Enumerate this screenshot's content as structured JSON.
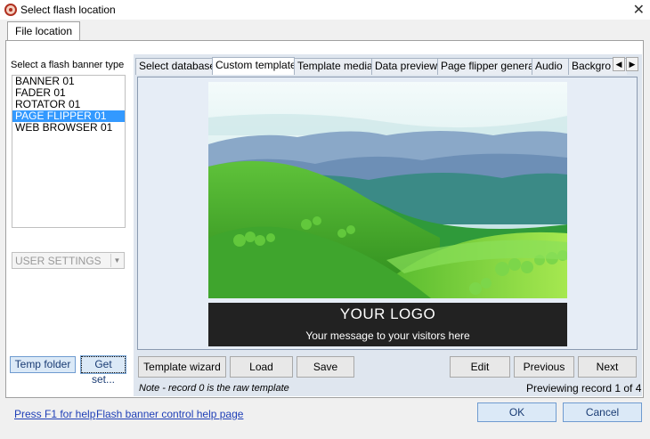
{
  "window": {
    "title": "Select flash location",
    "close_icon": "close-icon",
    "app_icon": "app-logo-icon"
  },
  "outer_tabs": [
    {
      "label": "File location",
      "active": true
    }
  ],
  "left": {
    "banner_type_label": "Select a flash banner type",
    "banner_types": [
      {
        "label": "BANNER 01",
        "selected": false
      },
      {
        "label": "FADER 01",
        "selected": false
      },
      {
        "label": "ROTATOR 01",
        "selected": false
      },
      {
        "label": "PAGE FLIPPER 01",
        "selected": true
      },
      {
        "label": "WEB BROWSER 01",
        "selected": false
      }
    ],
    "settings_combo_value": "USER SETTINGS",
    "temp_folder_label": "Temp folder",
    "get_settings_label": "Get set..."
  },
  "inner_tabs": [
    {
      "label": "Select database",
      "active": false
    },
    {
      "label": "Custom template",
      "active": true
    },
    {
      "label": "Template media",
      "active": false
    },
    {
      "label": "Data preview",
      "active": false
    },
    {
      "label": "Page flipper general",
      "active": false
    },
    {
      "label": "Audio",
      "active": false
    },
    {
      "label": "Backgro",
      "active": false
    }
  ],
  "preview": {
    "logo_text": "YOUR LOGO",
    "message_text": "Your message to your visitors here"
  },
  "toolbar": {
    "template_wizard": "Template wizard",
    "load": "Load",
    "save": "Save",
    "edit": "Edit",
    "previous": "Previous",
    "next": "Next"
  },
  "status": {
    "note": "Note - record 0 is the raw template",
    "previewing": "Previewing record 1 of 4"
  },
  "footer": {
    "help_link_f1": "Press F1 for help",
    "help_link_page": "Flash banner control help page",
    "ok": "OK",
    "cancel": "Cancel"
  },
  "colors": {
    "selection": "#3399ff",
    "link": "#1f3fb7",
    "logo_bar": "#222222"
  }
}
